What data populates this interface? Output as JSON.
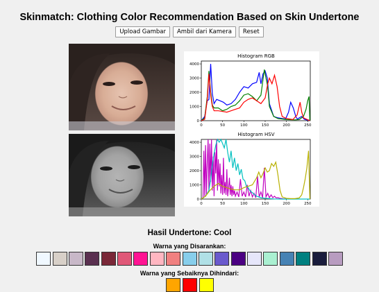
{
  "app": {
    "title": "Skinmatch: Clothing Color Recommendation Based on Skin Undertone"
  },
  "toolbar": {
    "upload_label": "Upload Gambar",
    "camera_label": "Ambil dari Kamera",
    "reset_label": "Reset"
  },
  "result": {
    "undertone_text": "Hasil Undertone: Cool",
    "recommended_label": "Warna yang Disarankan:",
    "avoid_label": "Warna yang Sebaiknya Dihindari:"
  },
  "recommended_colors": [
    "#f0f8ff",
    "#d8d0c8",
    "#c8b8c8",
    "#5a3050",
    "#7a2838",
    "#e05878",
    "#ff1493",
    "#ffb6c1",
    "#f08080",
    "#87ceeb",
    "#b0e0e6",
    "#6a5acd",
    "#4b0082",
    "#e6e6fa",
    "#aaf0d1",
    "#4682b4",
    "#008080",
    "#191c3c",
    "#b89cc0"
  ],
  "avoid_colors": [
    "#ffa500",
    "#ff0000",
    "#ffff00"
  ],
  "chart_data": [
    {
      "type": "line",
      "title": "Histogram RGB",
      "xlim": [
        0,
        256
      ],
      "ylim": [
        0,
        4200
      ],
      "xticks": [
        0,
        50,
        100,
        150,
        200,
        250
      ],
      "yticks": [
        0,
        1000,
        2000,
        3000,
        4000
      ],
      "series": [
        {
          "color": "#0000ff",
          "x": [
            0,
            8,
            14,
            18,
            22,
            26,
            30,
            36,
            44,
            52,
            60,
            70,
            80,
            90,
            100,
            110,
            120,
            130,
            136,
            140,
            145,
            150,
            155,
            160,
            170,
            180,
            190,
            198,
            205,
            210,
            216,
            222,
            226,
            230,
            236,
            242,
            248,
            252,
            255
          ],
          "y": [
            0,
            300,
            1400,
            1500,
            4000,
            1900,
            1200,
            1500,
            1400,
            1300,
            1100,
            1200,
            1500,
            2000,
            2400,
            2300,
            2600,
            2700,
            3400,
            2600,
            3300,
            3500,
            3000,
            1200,
            300,
            200,
            150,
            120,
            600,
            1300,
            900,
            300,
            100,
            200,
            300,
            100,
            50,
            50,
            0
          ]
        },
        {
          "color": "#008000",
          "x": [
            0,
            8,
            14,
            18,
            22,
            26,
            30,
            40,
            50,
            60,
            70,
            80,
            90,
            100,
            110,
            120,
            130,
            140,
            148,
            152,
            156,
            160,
            170,
            180,
            200,
            220,
            230,
            240,
            246,
            250,
            253,
            255
          ],
          "y": [
            0,
            200,
            1700,
            3500,
            2000,
            1100,
            900,
            900,
            700,
            800,
            1000,
            1100,
            1400,
            1800,
            1900,
            1700,
            1400,
            1800,
            3600,
            3000,
            2400,
            1000,
            300,
            150,
            80,
            60,
            80,
            300,
            800,
            1400,
            1700,
            0
          ]
        },
        {
          "color": "#ff0000",
          "x": [
            0,
            8,
            14,
            18,
            22,
            26,
            30,
            40,
            50,
            60,
            70,
            80,
            90,
            100,
            110,
            120,
            130,
            140,
            150,
            156,
            160,
            166,
            172,
            178,
            184,
            190,
            200,
            215,
            225,
            232,
            236,
            240,
            255
          ],
          "y": [
            0,
            100,
            1500,
            3300,
            1800,
            1000,
            700,
            700,
            650,
            600,
            700,
            800,
            900,
            1300,
            1500,
            1600,
            1400,
            1200,
            1600,
            2600,
            3000,
            2600,
            3200,
            2400,
            1000,
            300,
            150,
            80,
            400,
            1300,
            600,
            200,
            0
          ]
        }
      ]
    },
    {
      "type": "line",
      "title": "Histogram HSV",
      "xlim": [
        0,
        256
      ],
      "ylim": [
        0,
        4200
      ],
      "xticks": [
        0,
        50,
        100,
        150,
        200,
        250
      ],
      "yticks": [
        0,
        1000,
        2000,
        3000,
        4000
      ],
      "series": [
        {
          "color": "#c000c0",
          "x": [
            0,
            4,
            6,
            8,
            10,
            12,
            14,
            16,
            18,
            20,
            22,
            24,
            26,
            28,
            30,
            32,
            34,
            36,
            38,
            40,
            42,
            44,
            46,
            48,
            50,
            52,
            54,
            56,
            58,
            60,
            62,
            64,
            66,
            68,
            70,
            72,
            74,
            76,
            78,
            80,
            84,
            88,
            92,
            96,
            100,
            104,
            108,
            112,
            116,
            120,
            124,
            128,
            132,
            136,
            140,
            144,
            148,
            152,
            156,
            160,
            164,
            168,
            172,
            176,
            180,
            184,
            188,
            192,
            196,
            200
          ],
          "y": [
            0,
            100,
            3400,
            200,
            3800,
            300,
            2600,
            4200,
            500,
            3900,
            1200,
            4200,
            600,
            3000,
            200,
            3300,
            1800,
            4200,
            600,
            2800,
            900,
            2500,
            400,
            1700,
            300,
            2900,
            400,
            1200,
            300,
            2100,
            200,
            800,
            1500,
            300,
            1000,
            200,
            900,
            300,
            600,
            200,
            500,
            150,
            1400,
            200,
            500,
            150,
            1000,
            200,
            600,
            150,
            400,
            100,
            1600,
            150,
            500,
            100,
            2200,
            150,
            400,
            100,
            300,
            100,
            200,
            80,
            100,
            60,
            40,
            20,
            10,
            0
          ]
        },
        {
          "color": "#00c0c0",
          "x": [
            0,
            10,
            18,
            22,
            26,
            30,
            34,
            38,
            42,
            46,
            50,
            54,
            58,
            62,
            66,
            70,
            74,
            78,
            82,
            86,
            90,
            94,
            98,
            102,
            106,
            110,
            114,
            118,
            122,
            126,
            130,
            140,
            150,
            160,
            170,
            180,
            200,
            255
          ],
          "y": [
            0,
            200,
            600,
            1400,
            2400,
            3200,
            3800,
            4200,
            4000,
            4200,
            3900,
            3600,
            4200,
            3300,
            2600,
            3400,
            2200,
            2900,
            2000,
            2500,
            1700,
            2100,
            1400,
            1300,
            900,
            800,
            600,
            500,
            400,
            300,
            200,
            100,
            60,
            30,
            10,
            0,
            0,
            0
          ]
        },
        {
          "color": "#b8b000",
          "x": [
            0,
            10,
            20,
            30,
            40,
            50,
            60,
            70,
            80,
            90,
            100,
            110,
            120,
            130,
            135,
            140,
            145,
            150,
            155,
            160,
            165,
            170,
            175,
            180,
            185,
            190,
            200,
            210,
            220,
            230,
            236,
            240,
            244,
            248,
            252,
            255
          ],
          "y": [
            0,
            200,
            600,
            900,
            1100,
            900,
            800,
            700,
            650,
            650,
            800,
            900,
            1000,
            1500,
            1900,
            1500,
            1800,
            2200,
            1900,
            2000,
            2500,
            2300,
            2600,
            1700,
            600,
            150,
            50,
            30,
            30,
            80,
            300,
            800,
            1400,
            2200,
            3400,
            0
          ]
        }
      ]
    }
  ]
}
